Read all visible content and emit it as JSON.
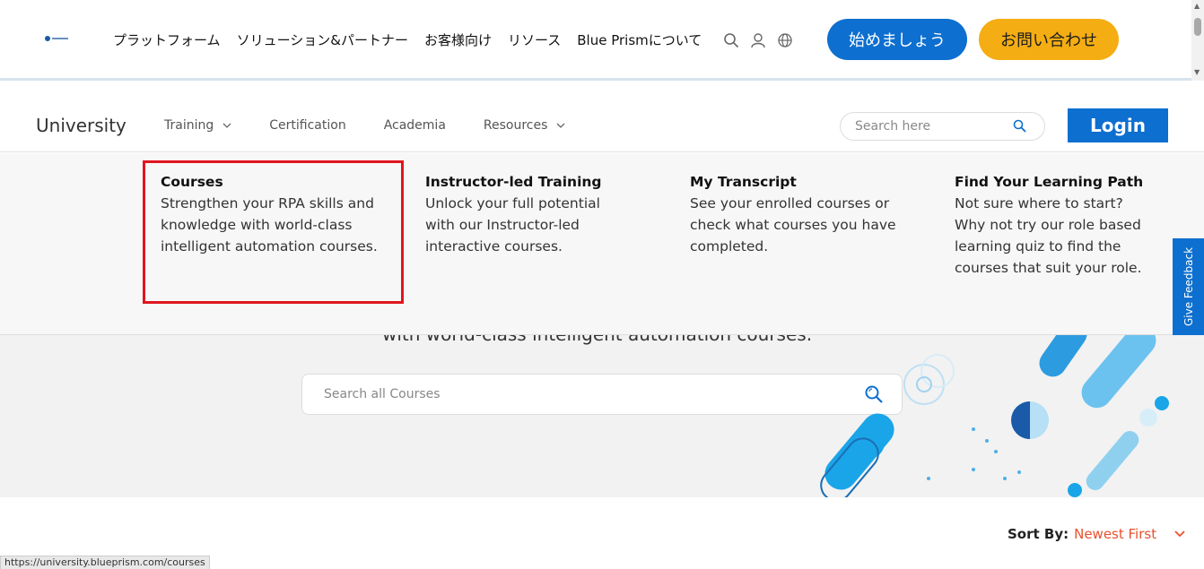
{
  "header": {
    "nav": [
      "プラットフォーム",
      "ソリューション&パートナー",
      "お客様向け",
      "リソース",
      "Blue Prismについて"
    ],
    "start_button": "始めましょう",
    "contact_button": "お問い合わせ"
  },
  "university": {
    "title": "University",
    "links": [
      {
        "label": "Training",
        "has_dropdown": true
      },
      {
        "label": "Certification",
        "has_dropdown": false
      },
      {
        "label": "Academia",
        "has_dropdown": false
      },
      {
        "label": "Resources",
        "has_dropdown": true
      }
    ],
    "search_placeholder": "Search here",
    "login": "Login"
  },
  "dropdown": {
    "items": [
      {
        "title": "Courses",
        "desc": "Strengthen your RPA skills and knowledge with world-class intelligent automation courses."
      },
      {
        "title": "Instructor-led Training",
        "desc": "Unlock your full potential with our Instructor-led interactive courses."
      },
      {
        "title": "My Transcript",
        "desc": "See your enrolled courses or check what courses you have completed."
      },
      {
        "title": "Find Your Learning Path",
        "desc": "Not sure where to start? Why not try our role based learning quiz to find the courses that suit your role."
      }
    ]
  },
  "hero": {
    "text": "with world-class intelligent automation courses.",
    "search_placeholder": "Search all Courses"
  },
  "feedback": "Give Feedback",
  "sort": {
    "label": "Sort By:",
    "value": "Newest First"
  },
  "status_url": "https://university.blueprism.com/courses",
  "colors": {
    "primary": "#0d6fcf",
    "accent": "#f4ad12",
    "highlight": "#e0151e",
    "sort_value": "#e8512e"
  }
}
